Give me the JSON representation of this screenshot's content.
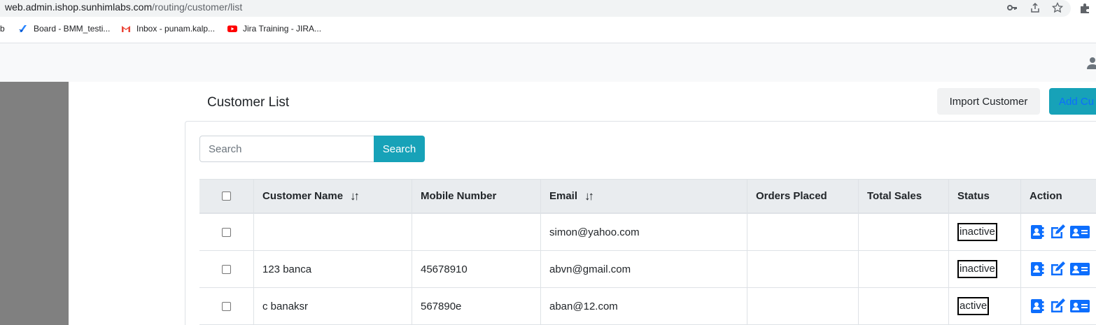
{
  "browser": {
    "url_host": "web.admin.ishop.sunhimlabs.com",
    "url_path": "/routing/customer/list",
    "bookmarks": [
      {
        "label": "b"
      },
      {
        "label": "Board - BMM_testi..."
      },
      {
        "label": "Inbox - punam.kalp..."
      },
      {
        "label": "Jira Training - JIRA..."
      }
    ]
  },
  "header": {
    "title": "Customer List",
    "import_label": "Import Customer",
    "add_label": "Add Cu"
  },
  "search": {
    "placeholder": "Search",
    "button_label": "Search"
  },
  "table": {
    "headers": {
      "name": "Customer Name",
      "mobile": "Mobile Number",
      "email": "Email",
      "orders": "Orders Placed",
      "sales": "Total Sales",
      "status": "Status",
      "action": "Action"
    },
    "sort_glyph": "↓↑",
    "rows": [
      {
        "name": "",
        "mobile": "",
        "email": "simon@yahoo.com",
        "orders": "",
        "sales": "",
        "status": "inactive"
      },
      {
        "name": "123 banca",
        "mobile": "45678910",
        "email": "abvn@gmail.com",
        "orders": "",
        "sales": "",
        "status": "inactive"
      },
      {
        "name": "c banaksr",
        "mobile": "567890e",
        "email": "aban@12.com",
        "orders": "",
        "sales": "",
        "status": "active"
      }
    ]
  },
  "colors": {
    "accent": "#17a2b8",
    "action_icon": "#0d6efd",
    "sidebar": "#808080",
    "table_header_bg": "#e9ecef"
  }
}
